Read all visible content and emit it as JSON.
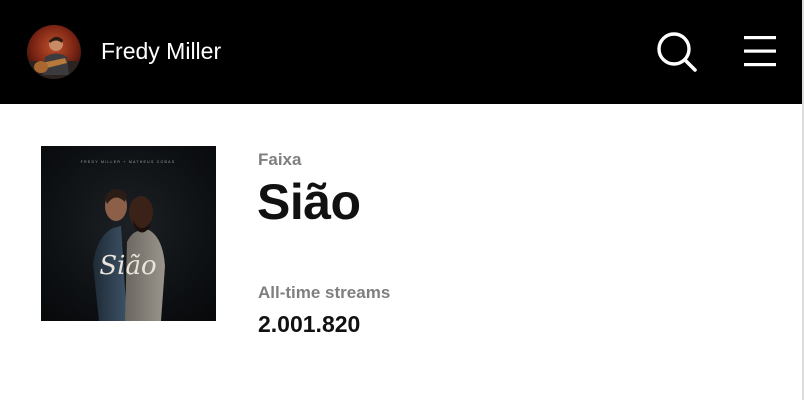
{
  "header": {
    "artist_name": "Fredy Miller",
    "avatar_icon": "artist-avatar",
    "search_icon": "search-icon",
    "menu_icon": "hamburger-menu-icon",
    "background_color": "#000000"
  },
  "track": {
    "type_label": "Faixa",
    "title": "Sião",
    "cover": {
      "credit_text": "FREDY MILLER + MATHEUS COBAS",
      "script_title": "Sião"
    },
    "streams": {
      "label": "All-time streams",
      "value": "2.001.820"
    }
  },
  "colors": {
    "muted_label": "#7f7f7f",
    "primary_text": "#111111"
  }
}
